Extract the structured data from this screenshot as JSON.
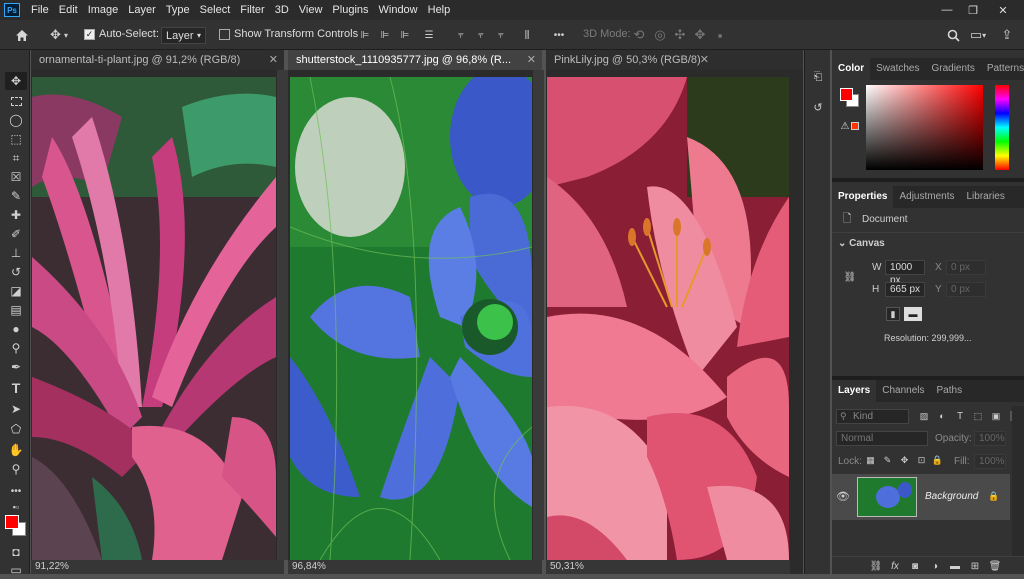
{
  "app": {
    "logo": "Ps"
  },
  "menu": [
    "File",
    "Edit",
    "Image",
    "Layer",
    "Type",
    "Select",
    "Filter",
    "3D",
    "View",
    "Plugins",
    "Window",
    "Help"
  ],
  "window_controls": {
    "minimize": "—",
    "restore": "❐",
    "close": "✕"
  },
  "options_bar": {
    "home_icon": "home-icon",
    "auto_select_label": "Auto-Select:",
    "auto_select_checked": true,
    "auto_select_target": "Layer",
    "show_transform_label": "Show Transform Controls",
    "show_transform_checked": false,
    "more_label": "•••",
    "mode_3d_label": "3D Mode:"
  },
  "documents": [
    {
      "tab": "ornamental-ti-plant.jpg @ 91,2% (RGB/8)",
      "zoom": "91,22%",
      "active": false
    },
    {
      "tab": "shutterstock_1110935777.jpg @ 96,8% (R...",
      "zoom": "96,84%",
      "active": true
    },
    {
      "tab": "PinkLily.jpg @ 50,3% (RGB/8)",
      "zoom": "50,31%",
      "active": false
    }
  ],
  "color_panel": {
    "tabs": [
      "Color",
      "Swatches",
      "Gradients",
      "Patterns"
    ],
    "foreground": "#ff0000",
    "background": "#ffffff",
    "hue": "#ff0000"
  },
  "properties_panel": {
    "tabs": [
      "Properties",
      "Adjustments",
      "Libraries"
    ],
    "doc_label": "Document",
    "section": "Canvas",
    "w_label": "W",
    "w_value": "1000 px",
    "h_label": "H",
    "h_value": "665 px",
    "x_label": "X",
    "x_value": "0 px",
    "y_label": "Y",
    "y_value": "0 px",
    "resolution": "Resolution: 299,999..."
  },
  "layers_panel": {
    "tabs": [
      "Layers",
      "Channels",
      "Paths"
    ],
    "kind_placeholder": "Kind",
    "blend_mode": "Normal",
    "opacity_label": "Opacity:",
    "opacity_value": "100%",
    "lock_label": "Lock:",
    "fill_label": "Fill:",
    "fill_value": "100%",
    "layer_name": "Background"
  }
}
